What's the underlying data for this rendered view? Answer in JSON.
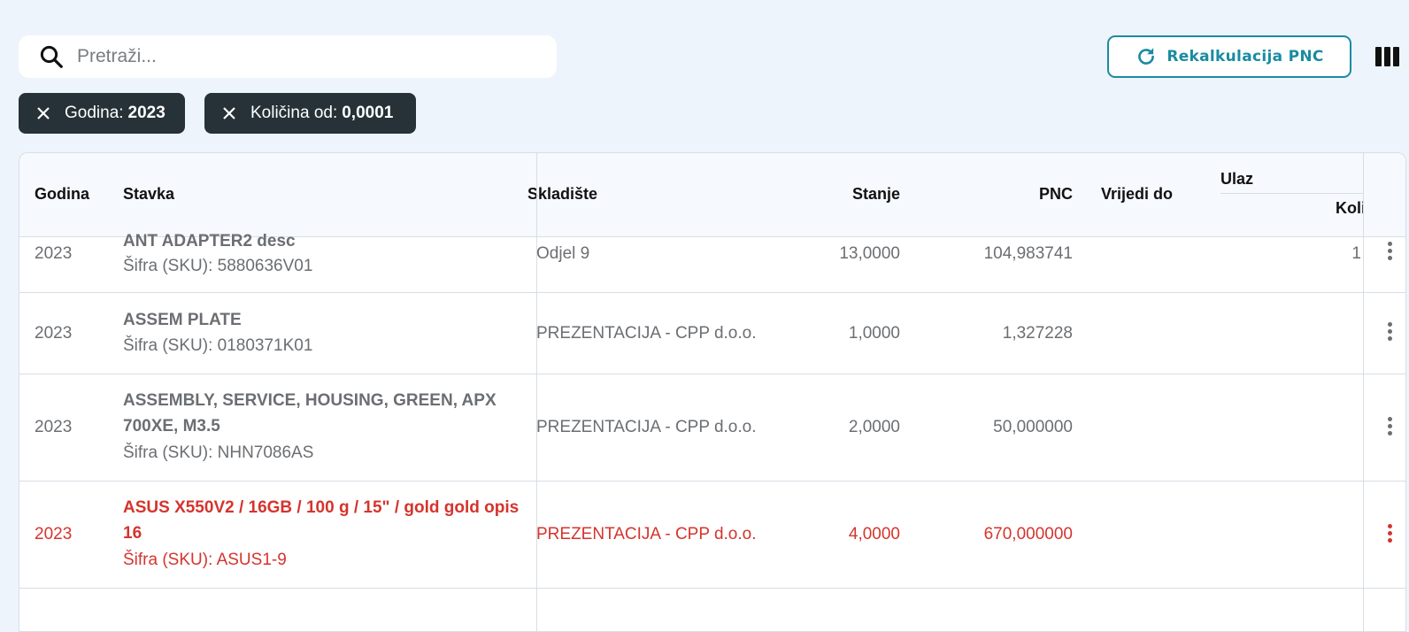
{
  "search": {
    "placeholder": "Pretraži..."
  },
  "toolbar": {
    "recalc_label": "Rekalkulacija PNC"
  },
  "filters": [
    {
      "label": "Godina:",
      "value": "2023"
    },
    {
      "label": "Količina od:",
      "value": "0,0001"
    }
  ],
  "table": {
    "headers": {
      "godina": "Godina",
      "stavka": "Stavka",
      "skladiste": "Skladište",
      "stanje": "Stanje",
      "pnc": "PNC",
      "vrijedi_do": "Vrijedi do",
      "ulaz": "Ulaz",
      "ulaz_kolicina": "Koli"
    },
    "rows": [
      {
        "godina": "2023",
        "name": "ANT ADAPTER2 desc",
        "sku": "Šifra (SKU): 5880636V01",
        "skladiste": "Odjel 9",
        "stanje": "13,0000",
        "pnc": "104,983741",
        "ulaz_kol": "1"
      },
      {
        "godina": "2023",
        "name": "ASSEM PLATE",
        "sku": "Šifra (SKU): 0180371K01",
        "skladiste": "PREZENTACIJA - CPP d.o.o.",
        "stanje": "1,0000",
        "pnc": "1,327228",
        "ulaz_kol": ""
      },
      {
        "godina": "2023",
        "name_line1": "ASSEMBLY, SERVICE, HOUSING, GREEN, APX",
        "name_line2": "700XE, M3.5",
        "sku": "Šifra (SKU): NHN7086AS",
        "skladiste": "PREZENTACIJA - CPP d.o.o.",
        "stanje": "2,0000",
        "pnc": "50,000000",
        "ulaz_kol": ""
      },
      {
        "godina": "2023",
        "name_line1": "ASUS X550V2 / 16GB / 100 g / 15\" / gold gold opis",
        "name_line2": "16",
        "sku": "Šifra (SKU): ASUS1-9",
        "skladiste": "PREZENTACIJA - CPP d.o.o.",
        "stanje": "4,0000",
        "pnc": "670,000000",
        "ulaz_kol": ""
      }
    ]
  },
  "colors": {
    "accent": "#1a8ba1",
    "chip_bg": "#263237",
    "warning_red": "#d5342d",
    "page_bg": "#eef4fc"
  }
}
